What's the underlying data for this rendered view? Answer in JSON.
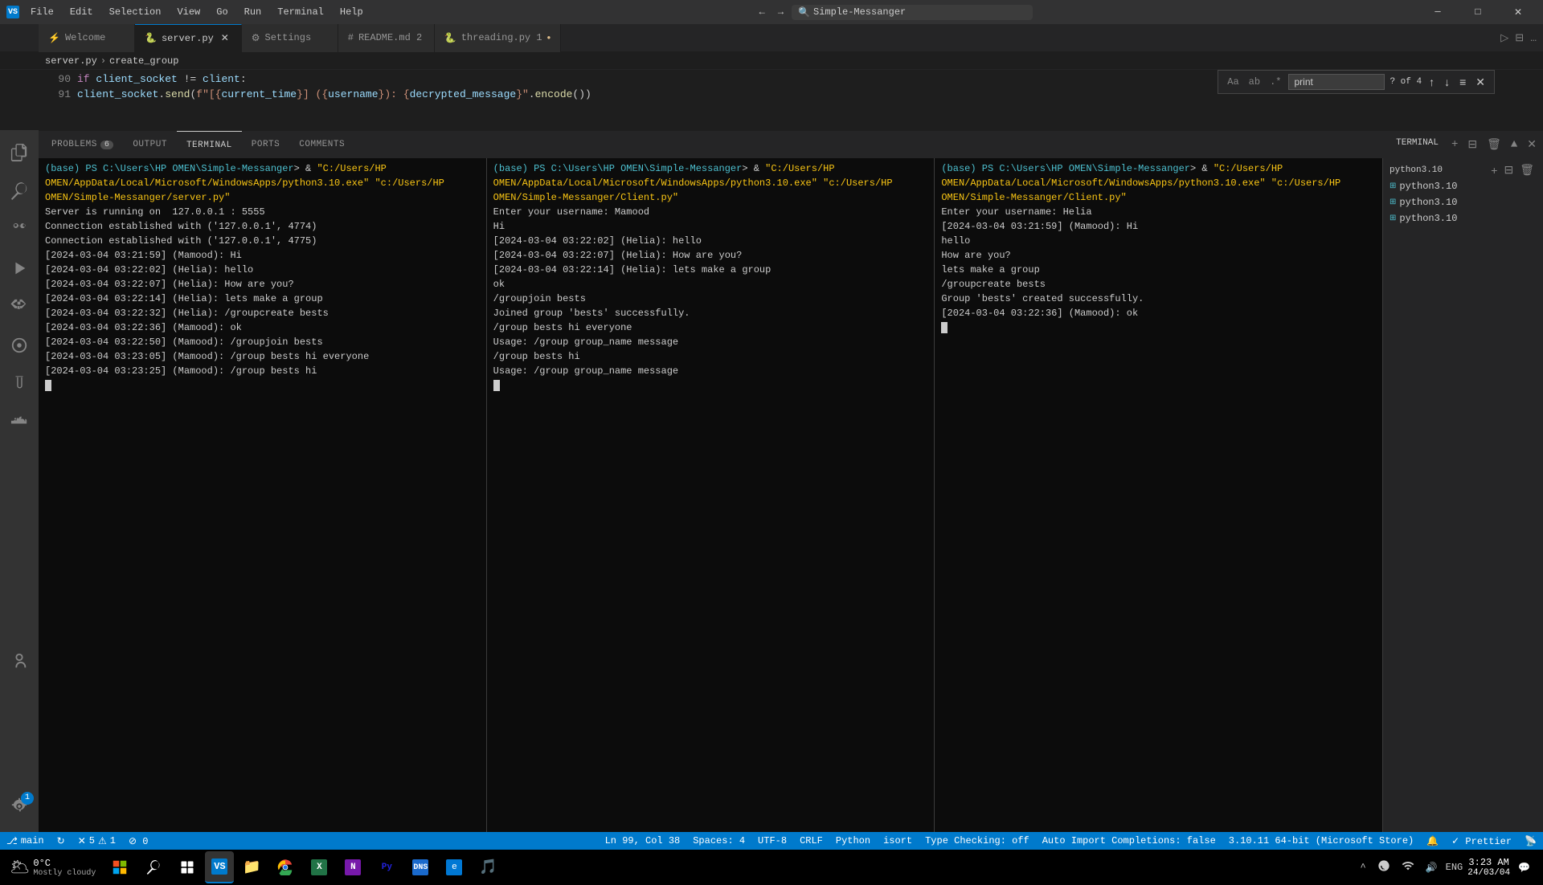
{
  "titleBar": {
    "appIcon": "VS",
    "menus": [
      "File",
      "Edit",
      "Selection",
      "View",
      "Go",
      "Run",
      "Terminal",
      "Help"
    ],
    "searchPlaceholder": "Simple-Messanger",
    "navBack": "←",
    "navForward": "→",
    "windowControls": [
      "─",
      "□",
      "✕"
    ]
  },
  "tabs": [
    {
      "id": "welcome",
      "label": "Welcome",
      "icon": "⚡",
      "active": false,
      "modified": false
    },
    {
      "id": "server-py",
      "label": "server.py",
      "icon": "🐍",
      "active": true,
      "modified": false
    },
    {
      "id": "settings",
      "label": "Settings",
      "icon": "⚙",
      "active": false,
      "modified": false
    },
    {
      "id": "readme",
      "label": "README.md 2",
      "icon": "#",
      "active": false,
      "modified": false
    },
    {
      "id": "threading",
      "label": "threading.py 1",
      "icon": "🐍",
      "active": false,
      "modified": true
    }
  ],
  "breadcrumb": {
    "file": "server.py",
    "symbol": "create_group"
  },
  "editor": {
    "lines": [
      {
        "num": "90",
        "content": "            if client_socket != client:"
      },
      {
        "num": "91",
        "content": "                client_socket.send(f\"[{current_time}] ({username}): {decrypted_message}\".encode())"
      }
    ]
  },
  "findBar": {
    "query": "print",
    "result": "? of 4",
    "placeholder": "print"
  },
  "panelTabs": [
    {
      "id": "problems",
      "label": "PROBLEMS",
      "badge": "6",
      "active": false
    },
    {
      "id": "output",
      "label": "OUTPUT",
      "badge": "",
      "active": false
    },
    {
      "id": "terminal",
      "label": "TERMINAL",
      "badge": "",
      "active": true
    },
    {
      "id": "ports",
      "label": "PORTS",
      "badge": "",
      "active": false
    },
    {
      "id": "comments",
      "label": "COMMENTS",
      "badge": "",
      "active": false
    }
  ],
  "terminalHeader": {
    "label": "TERMINAL"
  },
  "terminalInstances": [
    {
      "id": 1,
      "label": "python3.10",
      "active": false
    },
    {
      "id": 2,
      "label": "python3.10",
      "active": false
    },
    {
      "id": 3,
      "label": "python3.10",
      "active": false
    }
  ],
  "terminalPanes": [
    {
      "id": "pane1",
      "prompt": "(base) PS C:\\Users\\HP OMEN\\Simple-Messanger> & ",
      "cmd": "\"C:/Users/HP OMEN/AppData/Local/Microsoft/WindowsApps/python3.10.exe\" \"c:/Users/HP OMEN/Simple-Messanger/server.py\"",
      "output": [
        "Server is running on  127.0.0.1 : 5555",
        "Connection established with ('127.0.0.1', 4774)",
        "Connection established with ('127.0.0.1', 4775)",
        "[2024-03-04 03:21:59] (Mamood): Hi",
        "[2024-03-04 03:22:02] (Helia): hello",
        "[2024-03-04 03:22:07] (Helia): How are you?",
        "[2024-03-04 03:22:14] (Helia): lets make a group",
        "[2024-03-04 03:22:32] (Helia): /groupcreate bests",
        "[2024-03-04 03:22:36] (Mamood): ok",
        "[2024-03-04 03:22:50] (Mamood): /groupjoin bests",
        "[2024-03-04 03:23:05] (Mamood): /group bests hi everyone",
        "[2024-03-04 03:23:25] (Mamood): /group bests hi"
      ]
    },
    {
      "id": "pane2",
      "prompt": "(base) PS C:\\Users\\HP OMEN\\Simple-Messanger> & ",
      "cmd": "\"C:/Users/HP OMEN/AppData/Local/Microsoft/WindowsApps/python3.10.exe\" \"c:/Users/HP OMEN/Simple-Messanger/Client.py\"",
      "output": [
        "Enter your username: Mamood",
        "Hi",
        "[2024-03-04 03:22:02] (Helia): hello",
        "[2024-03-04 03:22:07] (Helia): How are you?",
        "[2024-03-04 03:22:14] (Helia): lets make a group",
        "ok",
        "/groupjoin bests",
        "Joined group 'bests' successfully.",
        "/group bests hi everyone",
        "Usage: /group group_name message",
        "/group bests hi",
        "Usage: /group group_name message"
      ]
    },
    {
      "id": "pane3",
      "prompt": "(base) PS C:\\Users\\HP OMEN\\Simple-Messanger> & ",
      "cmd": "\"C:/Users/HP OMEN/AppData/Local/Microsoft/WindowsApps/python3.10.exe\" \"c:/Users/HP OMEN/Simple-Messanger/Client.py\"",
      "output": [
        "Enter your username: Helia",
        "[2024-03-04 03:21:59] (Mamood): Hi",
        "hello",
        "How are you?",
        "lets make a group",
        "/groupcreate bests",
        "Group 'bests' created successfully.",
        "[2024-03-04 03:22:36] (Mamood): ok"
      ]
    }
  ],
  "statusBar": {
    "branch": "main",
    "sync": "↻",
    "errors": "5",
    "warnings": "1",
    "noConfig": "⊘ 0",
    "location": "Ln 99, Col 38",
    "spaces": "Spaces: 4",
    "encoding": "UTF-8",
    "lineEnding": "CRLF",
    "language": "Python",
    "formatter": "isort",
    "typeChecking": "Type Checking: off",
    "autoImport": "Auto Import Completions: false",
    "pythonVersion": "3.10.11 64-bit (Microsoft Store)",
    "prettier": "Prettier"
  },
  "taskbar": {
    "weather": "0°C",
    "weatherDesc": "Mostly cloudy",
    "time": "3:23 AM",
    "date": "24/03/04",
    "language": "ENG"
  },
  "activityBar": {
    "items": [
      {
        "id": "explorer",
        "icon": "⎘",
        "active": false
      },
      {
        "id": "search",
        "icon": "🔍",
        "active": false
      },
      {
        "id": "source-control",
        "icon": "⑂",
        "active": false
      },
      {
        "id": "run-debug",
        "icon": "▷",
        "active": false
      },
      {
        "id": "extensions",
        "icon": "⊞",
        "active": false
      },
      {
        "id": "remote",
        "icon": "◎",
        "active": false
      },
      {
        "id": "testing",
        "icon": "⚗",
        "active": false
      },
      {
        "id": "docker",
        "icon": "🐳",
        "active": false
      },
      {
        "id": "live-share",
        "icon": "↗",
        "active": false
      }
    ],
    "bottomItems": [
      {
        "id": "accounts",
        "icon": "👤",
        "active": false
      },
      {
        "id": "manage",
        "icon": "⚙",
        "badge": "1",
        "active": false
      }
    ]
  }
}
